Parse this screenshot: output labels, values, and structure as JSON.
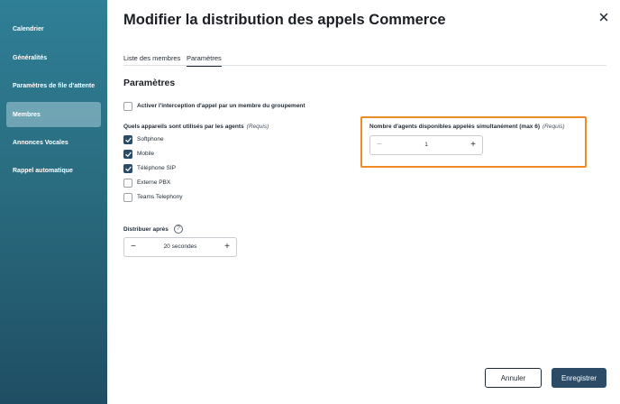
{
  "sidebar": {
    "items": [
      {
        "label": "Calendrier"
      },
      {
        "label": "Généralités"
      },
      {
        "label": "Paramètres de file d'attente"
      },
      {
        "label": "Membres"
      },
      {
        "label": "Annonces Vocales"
      },
      {
        "label": "Rappel automatique"
      }
    ],
    "active": "Membres"
  },
  "header": {
    "title": "Modifier la distribution des appels Commerce"
  },
  "tabs": [
    {
      "label": "Liste des membres"
    },
    {
      "label": "Paramètres"
    }
  ],
  "active_tab": "Paramètres",
  "section": {
    "title": "Paramètres"
  },
  "intercept": {
    "label": "Activer l'interception d'appel par un membre du groupement",
    "checked": false
  },
  "devices": {
    "label": "Quels appareils sont utilisés par les agents",
    "required": "(Requis)",
    "options": [
      {
        "label": "Softphone",
        "checked": true
      },
      {
        "label": "Mobile",
        "checked": true
      },
      {
        "label": "Téléphone SIP",
        "checked": true
      },
      {
        "label": "Externe PBX",
        "checked": false
      },
      {
        "label": "Teams Telephony",
        "checked": false
      }
    ]
  },
  "agents": {
    "label": "Nombre d'agents disponibles appelés simultanément (max 6)",
    "required": "(Requis)",
    "value": "1",
    "minus": "−",
    "plus": "+"
  },
  "distribute": {
    "label": "Distribuer après",
    "value": "20 secondes",
    "help": "?",
    "minus": "−",
    "plus": "+"
  },
  "footer": {
    "cancel": "Annuler",
    "save": "Enregistrer"
  },
  "colors": {
    "highlight": "#f08a24",
    "primary": "#2b4b66",
    "sidebar": "#2a6c80"
  },
  "icons": {
    "close": "close-icon",
    "check": "check-icon",
    "help": "help-icon"
  }
}
